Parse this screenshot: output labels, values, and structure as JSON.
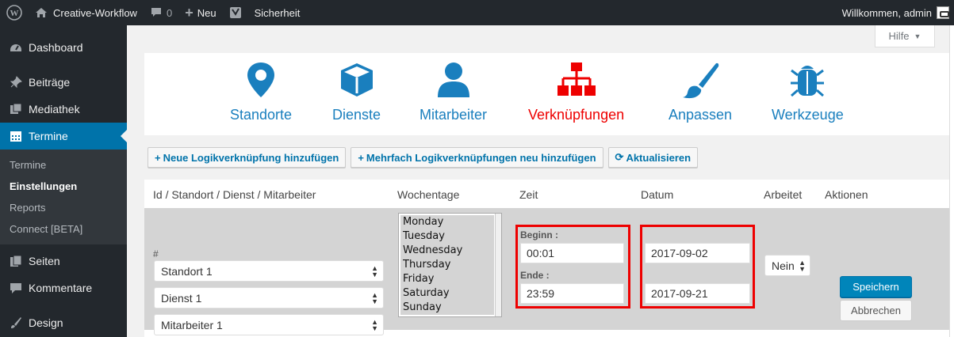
{
  "adminbar": {
    "site_name": "Creative-Workflow",
    "comments_count": "0",
    "new_label": "Neu",
    "security_label": "Sicherheit",
    "welcome": "Willkommen, admin"
  },
  "sidebar": {
    "items": [
      {
        "label": "Dashboard",
        "icon": "dashboard-icon"
      },
      {
        "label": "Beiträge",
        "icon": "pin-icon"
      },
      {
        "label": "Mediathek",
        "icon": "media-icon"
      },
      {
        "label": "Termine",
        "icon": "calendar-icon"
      },
      {
        "label": "Seiten",
        "icon": "pages-icon"
      },
      {
        "label": "Kommentare",
        "icon": "comment-icon"
      },
      {
        "label": "Design",
        "icon": "brush-icon"
      }
    ],
    "submenu": [
      "Termine",
      "Einstellungen",
      "Reports",
      "Connect [BETA]"
    ]
  },
  "help_tab": "Hilfe",
  "nav": {
    "tiles": [
      {
        "label": "Standorte",
        "icon": "map-pin-icon",
        "color": "#1a7fbe"
      },
      {
        "label": "Dienste",
        "icon": "cube-icon",
        "color": "#1a7fbe"
      },
      {
        "label": "Mitarbeiter",
        "icon": "user-icon",
        "color": "#1a7fbe"
      },
      {
        "label": "Verknüpfungen",
        "icon": "sitemap-icon",
        "color": "#ee0000"
      },
      {
        "label": "Anpassen",
        "icon": "paintbrush-icon",
        "color": "#1a7fbe"
      },
      {
        "label": "Werkzeuge",
        "icon": "bug-icon",
        "color": "#1a7fbe"
      }
    ]
  },
  "actions": {
    "add_logic": "Neue Logikverknüpfung hinzufügen",
    "add_multi": "Mehrfach Logikverknüpfungen neu hinzufügen",
    "refresh": "Aktualisieren"
  },
  "table": {
    "headers": [
      "Id / Standort / Dienst / Mitarbeiter",
      "Wochentage",
      "Zeit",
      "Datum",
      "Arbeitet",
      "Aktionen"
    ],
    "row": {
      "id": "#",
      "standort": "Standort 1",
      "dienst": "Dienst 1",
      "mitarbeiter": "Mitarbeiter 1",
      "weekdays": [
        "Monday",
        "Tuesday",
        "Wednesday",
        "Thursday",
        "Friday",
        "Saturday",
        "Sunday"
      ],
      "begin_label": "Beginn :",
      "begin_time": "00:01",
      "end_label": "Ende :",
      "end_time": "23:59",
      "date_start": "2017-09-02",
      "date_end": "2017-09-21",
      "works": "Nein",
      "save": "Speichern",
      "cancel": "Abbrechen"
    }
  }
}
